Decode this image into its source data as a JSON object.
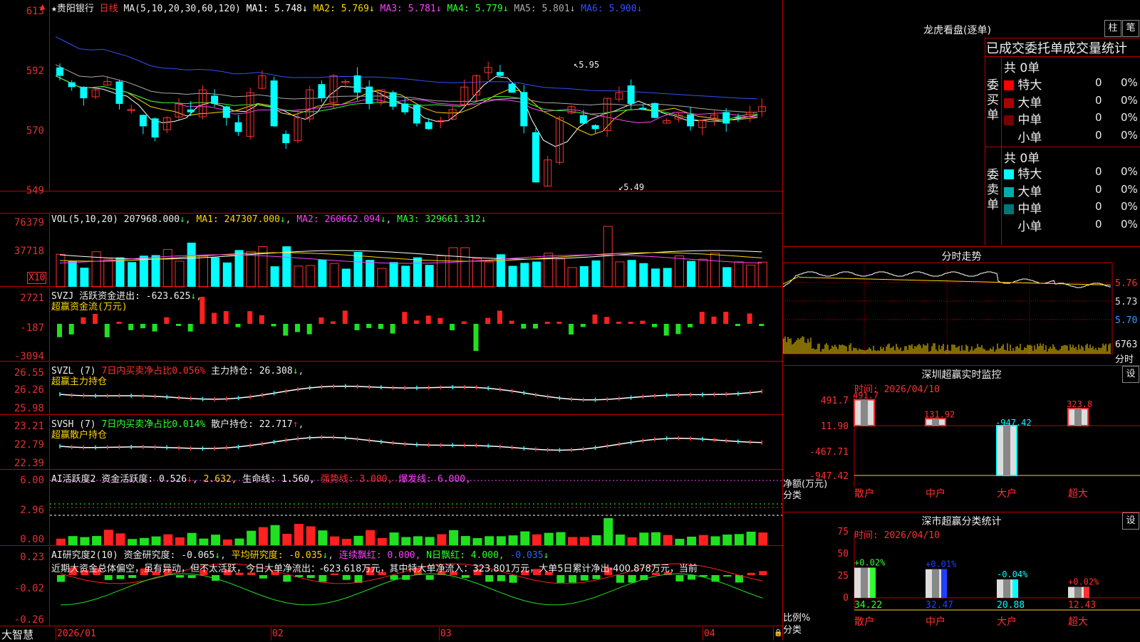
{
  "price": {
    "name": "★贵阳银行",
    "period": "日线",
    "ma_label": "MA(5,10,20,30,60,120)",
    "ma": [
      {
        "label": "MA1:",
        "val": "5.748",
        "color": "#ffffff"
      },
      {
        "label": "MA2:",
        "val": "5.769",
        "color": "#ffd700"
      },
      {
        "label": "MA3:",
        "val": "5.781",
        "color": "#ff40ff"
      },
      {
        "label": "MA4:",
        "val": "5.779",
        "color": "#30ff30"
      },
      {
        "label": "MA5:",
        "val": "5.801",
        "color": "#aaaaaa"
      },
      {
        "label": "MA6:",
        "val": "5.900",
        "color": "#3050ff"
      }
    ],
    "ticks": [
      "613",
      "592",
      "570",
      "549"
    ],
    "high_mark": "5.95",
    "low_mark": "5.49"
  },
  "vol": {
    "title": "VOL(5,10,20)",
    "val": "207968.000",
    "ma1": "MA1: 247307.000",
    "ma2": "MA2: 260662.094",
    "ma3": "MA3: 329661.312",
    "ticks": [
      "76379",
      "37718"
    ],
    "unit": "X10"
  },
  "svzj": {
    "title": "SVZJ",
    "desc": "活跃资金进出: -623.625",
    "sub": "超赢资金流(万元)",
    "ticks": [
      "2721",
      "-187",
      "-3094"
    ]
  },
  "svzl": {
    "title": "SVZL (7)",
    "desc1": "7日内买卖净占比0.056%",
    "desc2": "主力持仓: 26.308",
    "sub": "超赢主力持仓",
    "ticks": [
      "26.55",
      "26.26",
      "25.98"
    ]
  },
  "svsh": {
    "title": "SVSH (7)",
    "desc1": "7日内买卖净占比0.014%",
    "desc2": "散户持仓: 22.717",
    "sub": "超赢散户持仓",
    "ticks": [
      "23.21",
      "22.79",
      "22.39"
    ]
  },
  "ai1": {
    "title": "AI活跃度2",
    "desc": "资金活跃度: 0.526",
    "v2": "2.632,",
    "life": "生命线: 1.560,",
    "strong": "强势线: 3.000,",
    "burst": "爆发线: 6.000,",
    "ticks": [
      "6.00",
      "2.96",
      "0.00"
    ]
  },
  "ai2": {
    "title": "AI研究度2(10)",
    "desc": "资金研究度: -0.065",
    "avg": "平均研究度: -0.035",
    "lianxu": "连续飘红: 0.000,",
    "nday": "N日飘红: 4.000,",
    "last": "-0.035",
    "summary": "近期大资金总体偏空，虽有异动，但不太活跃，今日大单净流出：-623.618万元，其中特大单净流入：323.801万元，大单5日累计净出-400.878万元，当前",
    "ticks": [
      "0.23",
      "-0.02",
      "-0.26"
    ]
  },
  "xaxis": {
    "logo": "大智慧",
    "labels": [
      "2026/01",
      "02",
      "03",
      "04"
    ]
  },
  "dragon": {
    "title": "龙虎看盘(逐单)",
    "btn1": "柱",
    "btn2": "笔",
    "header": "已成交委托单成交量统计",
    "buy_label": "委买单",
    "sell_label": "委卖单",
    "buy_total": "共 0单",
    "sell_total": "共 0单",
    "buy_rows": [
      {
        "name": "特大",
        "count": "0",
        "pct": "0%",
        "color": "#ff0000"
      },
      {
        "name": "大单",
        "count": "0",
        "pct": "0%",
        "color": "#aa0000"
      },
      {
        "name": "中单",
        "count": "0",
        "pct": "0%",
        "color": "#770000"
      },
      {
        "name": "小单",
        "count": "0",
        "pct": "0%",
        "color": "#000000"
      }
    ],
    "sell_rows": [
      {
        "name": "特大",
        "count": "0",
        "pct": "0%",
        "color": "#00ffff"
      },
      {
        "name": "大单",
        "count": "0",
        "pct": "0%",
        "color": "#00aaaa"
      },
      {
        "name": "中单",
        "count": "0",
        "pct": "0%",
        "color": "#007777"
      },
      {
        "name": "小单",
        "count": "0",
        "pct": "0%",
        "color": "#000000"
      }
    ]
  },
  "intraday": {
    "title": "分时走势",
    "ticks": [
      "5.76",
      "5.73",
      "5.70"
    ],
    "vol_tick": "6763",
    "vol_unit": "分时"
  },
  "sz_monitor": {
    "title": "深圳超赢实时监控",
    "btn": "设",
    "time": "时间: 2026/04/10",
    "ticks": [
      "491.7",
      "11.90",
      "-467.71",
      "-947.42"
    ],
    "ylabel": "净额(万元)",
    "xlabel": "分类",
    "bars": [
      {
        "cat": "散户",
        "val": 491.7,
        "label": "491.7"
      },
      {
        "cat": "中户",
        "val": 131.92,
        "label": "131.92"
      },
      {
        "cat": "大户",
        "val": -947.42,
        "label": "-947.42"
      },
      {
        "cat": "超大",
        "val": 323.8,
        "label": "323.8"
      }
    ]
  },
  "sz_class": {
    "title": "深市超赢分类统计",
    "btn": "设",
    "time": "时间: 2026/04/10",
    "ticks": [
      "75",
      "50",
      "25",
      "0"
    ],
    "ylabel": "比例%",
    "xlabel": "分类",
    "bars": [
      {
        "cat": "散户",
        "val": 34.22,
        "delta": "+0.02%",
        "color": "#30ff30"
      },
      {
        "cat": "中户",
        "val": 32.47,
        "delta": "+0.01%",
        "color": "#2040ff"
      },
      {
        "cat": "大户",
        "val": 20.88,
        "delta": "-0.04%",
        "color": "#00ffff"
      },
      {
        "cat": "超大",
        "val": 12.43,
        "delta": "+0.02%",
        "color": "#ff3030"
      }
    ]
  }
}
